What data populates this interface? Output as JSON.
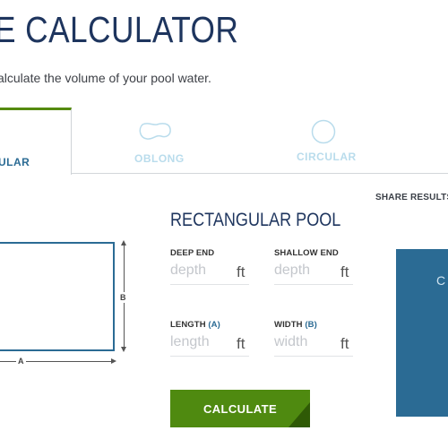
{
  "header": {
    "title": "E CALCULATOR",
    "subtitle": "alculate the volume of your pool water."
  },
  "tabs": [
    {
      "id": "rectangular",
      "label": "ULAR",
      "active": true
    },
    {
      "id": "oblong",
      "label": "OBLONG",
      "active": false
    },
    {
      "id": "circular",
      "label": "CIRCULAR",
      "active": false
    }
  ],
  "share": {
    "label": "SHARE RESULTS"
  },
  "diagram": {
    "dim_a": "A",
    "dim_b": "B"
  },
  "form": {
    "title": "RECTANGULAR POOL",
    "fields": [
      {
        "label": "DEEP END",
        "accent": "",
        "placeholder": "depth",
        "unit": "ft"
      },
      {
        "label": "SHALLOW END",
        "accent": "",
        "placeholder": "depth",
        "unit": "ft"
      },
      {
        "label": "LENGTH",
        "accent": "(A)",
        "placeholder": "length",
        "unit": "ft"
      },
      {
        "label": "WIDTH",
        "accent": "(B)",
        "placeholder": "width",
        "unit": "ft"
      }
    ],
    "submit_label": "CALCULATE"
  },
  "results": {
    "partial_text": "C"
  },
  "colors": {
    "accent_green": "#4f8a10",
    "accent_blue": "#2b6b94",
    "title_navy": "#1e355e"
  },
  "icons": {
    "oblong": "oblong-pool-icon",
    "circular": "circular-pool-icon",
    "rectangular": "rectangular-pool-icon"
  }
}
